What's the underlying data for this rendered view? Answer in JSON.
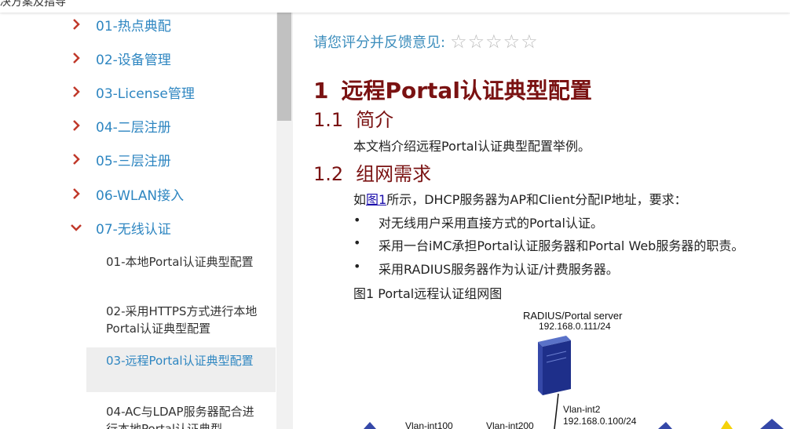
{
  "topbar": {
    "title": "决方案及指导"
  },
  "sidebar": {
    "items": [
      {
        "label": "01-热点典配",
        "expanded": false
      },
      {
        "label": "02-设备管理",
        "expanded": false
      },
      {
        "label": "03-License管理",
        "expanded": false
      },
      {
        "label": "04-二层注册",
        "expanded": false
      },
      {
        "label": "05-三层注册",
        "expanded": false
      },
      {
        "label": "06-WLAN接入",
        "expanded": false
      },
      {
        "label": "07-无线认证",
        "expanded": true
      }
    ],
    "subitems": [
      {
        "label": "01-本地Portal认证典型配置",
        "active": false
      },
      {
        "label": "02-采用HTTPS方式进行本地Portal认证典型配置",
        "active": false
      },
      {
        "label": "03-远程Portal认证典型配置",
        "active": true
      },
      {
        "label": "04-AC与LDAP服务器配合进行本地Portal认证典型",
        "active": false
      }
    ]
  },
  "rating": {
    "label": "请您评分并反馈意见:",
    "stars": [
      "☆",
      "☆",
      "☆",
      "☆",
      "☆"
    ]
  },
  "article": {
    "h1_num": "1",
    "h1_text": "远程Portal认证典型配置",
    "s1_num": "1.1",
    "s1_text": "简介",
    "intro": "本文档介绍远程Portal认证典型配置举例。",
    "s2_num": "1.2",
    "s2_text": "组网需求",
    "req_prefix": "如",
    "req_link": "图1",
    "req_suffix": "所示，DHCP服务器为AP和Client分配IP地址，要求：",
    "bullets": [
      "对无线用户采用直接方式的Portal认证。",
      "采用一台iMC承担Portal认证服务器和Portal Web服务器的职责。",
      "采用RADIUS服务器作为认证/计费服务器。"
    ],
    "figure_caption": "图1 Portal远程认证组网图"
  },
  "diagram": {
    "server_label": "RADIUS/Portal server",
    "server_ip": "192.168.0.111/24",
    "vlan_int2": "Vlan-int2",
    "vlan_int2_ip": "192.168.0.100/24",
    "vlan_int100": "Vlan-int100",
    "vlan_int200": "Vlan-int200"
  },
  "colors": {
    "link": "#2e86c1",
    "heading": "#7a1212",
    "active_bg": "#eeeeee",
    "arrow": "#c0392b"
  }
}
